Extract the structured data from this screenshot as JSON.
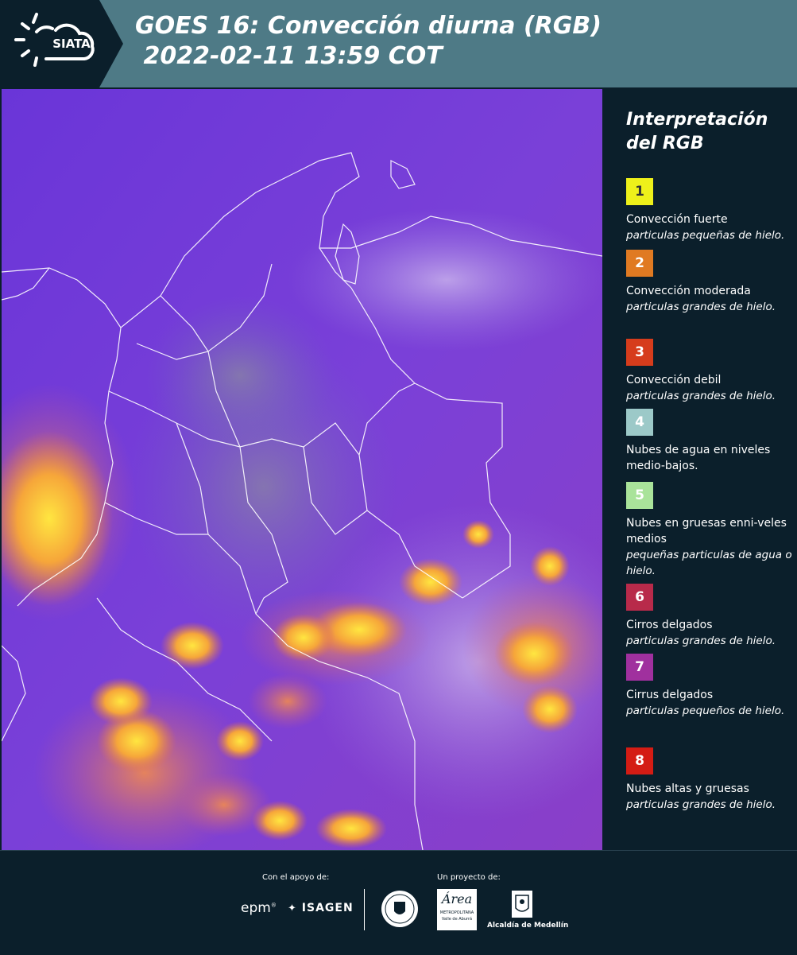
{
  "header": {
    "logo_text": "SIATA",
    "title_line1": "GOES 16: Convección diurna (RGB)",
    "title_line2": " 2022-02-11 13:59 COT"
  },
  "legend": {
    "title_line1": "Interpretación",
    "title_line2": "del RGB",
    "items": [
      {
        "num": "1",
        "color": "#eef01a",
        "num_color": "#333333",
        "name": "Convección fuerte",
        "desc": "particulas pequeñas de hielo."
      },
      {
        "num": "2",
        "color": "#e07a22",
        "num_color": "#ffffff",
        "name": "Convección moderada",
        "desc": "particulas grandes de hielo."
      },
      {
        "num": "3",
        "color": "#d63c1c",
        "num_color": "#ffffff",
        "name": "Convección debil",
        "desc": "particulas grandes de hielo."
      },
      {
        "num": "4",
        "color": "#9cc9c8",
        "num_color": "#ffffff",
        "name": "Nubes de agua en niveles medio-bajos.",
        "desc": ""
      },
      {
        "num": "5",
        "color": "#a9e39a",
        "num_color": "#ffffff",
        "name": "Nubes en gruesas enni-veles medios",
        "desc": "pequeñas particulas de agua o hielo."
      },
      {
        "num": "6",
        "color": "#b82a4a",
        "num_color": "#ffffff",
        "name": "Cirros delgados",
        "desc": "particulas grandes de hielo."
      },
      {
        "num": "7",
        "color": "#a0309e",
        "num_color": "#ffffff",
        "name": "Cirrus delgados",
        "desc": "particulas pequeños de hielo."
      },
      {
        "num": "8",
        "color": "#d41c14",
        "num_color": "#ffffff",
        "name": "Nubes altas y gruesas",
        "desc": "particulas grandes de hielo."
      }
    ]
  },
  "footer": {
    "support_label": "Con el apoyo de:",
    "project_label": "Un proyecto de:",
    "epm": "epm",
    "isagen": "ISAGEN",
    "area_line1": "Área",
    "area_line2": "METROPOLITANA",
    "area_line3": "Valle de Aburrá",
    "alcaldia": "Alcaldía de Medellín"
  }
}
